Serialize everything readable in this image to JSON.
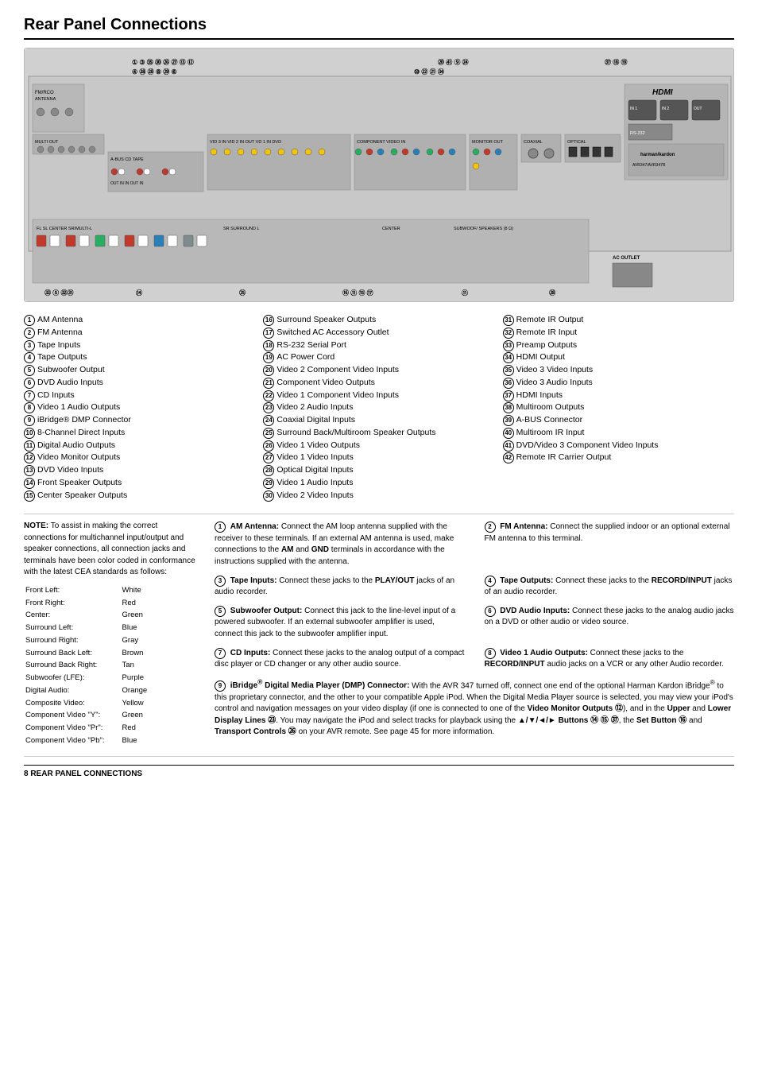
{
  "page": {
    "title": "Rear Panel Connections",
    "footer": "8   REAR PANEL CONNECTIONS"
  },
  "items": {
    "column1": [
      {
        "num": "1",
        "label": "AM Antenna"
      },
      {
        "num": "2",
        "label": "FM Antenna"
      },
      {
        "num": "3",
        "label": "Tape Inputs"
      },
      {
        "num": "4",
        "label": "Tape Outputs"
      },
      {
        "num": "5",
        "label": "Subwoofer Output"
      },
      {
        "num": "6",
        "label": "DVD Audio Inputs"
      },
      {
        "num": "7",
        "label": "CD Inputs"
      },
      {
        "num": "8",
        "label": "Video 1 Audio Outputs"
      },
      {
        "num": "9",
        "label": "iBridge® DMP Connector"
      },
      {
        "num": "10",
        "label": "8-Channel Direct Inputs"
      },
      {
        "num": "11",
        "label": "Digital Audio Outputs"
      },
      {
        "num": "12",
        "label": "Video Monitor Outputs"
      },
      {
        "num": "13",
        "label": "DVD Video Inputs"
      },
      {
        "num": "14",
        "label": "Front Speaker Outputs"
      },
      {
        "num": "15",
        "label": "Center Speaker Outputs"
      }
    ],
    "column2": [
      {
        "num": "16",
        "label": "Surround Speaker Outputs"
      },
      {
        "num": "17",
        "label": "Switched AC Accessory Outlet"
      },
      {
        "num": "18",
        "label": "RS-232 Serial Port"
      },
      {
        "num": "19",
        "label": "AC Power Cord"
      },
      {
        "num": "20",
        "label": "Video 2 Component Video Inputs"
      },
      {
        "num": "21",
        "label": "Component Video Outputs"
      },
      {
        "num": "22",
        "label": "Video 1 Component Video Inputs"
      },
      {
        "num": "23",
        "label": "Video 2 Audio Inputs"
      },
      {
        "num": "24",
        "label": "Coaxial Digital Inputs"
      },
      {
        "num": "25",
        "label": "Surround Back/Multiroom Speaker Outputs"
      },
      {
        "num": "26",
        "label": "Video 1 Video Outputs"
      },
      {
        "num": "27",
        "label": "Video 1 Video Inputs"
      },
      {
        "num": "28",
        "label": "Optical Digital Inputs"
      },
      {
        "num": "29",
        "label": "Video 1 Audio Inputs"
      },
      {
        "num": "30",
        "label": "Video 2 Video Inputs"
      }
    ],
    "column3": [
      {
        "num": "31",
        "label": "Remote IR Output"
      },
      {
        "num": "32",
        "label": "Remote IR Input"
      },
      {
        "num": "33",
        "label": "Preamp Outputs"
      },
      {
        "num": "34",
        "label": "HDMI Output"
      },
      {
        "num": "35",
        "label": "Video 3 Video Inputs"
      },
      {
        "num": "36",
        "label": "Video 3 Audio Inputs"
      },
      {
        "num": "37",
        "label": "HDMI Inputs"
      },
      {
        "num": "38",
        "label": "Multiroom Outputs"
      },
      {
        "num": "39",
        "label": "A-BUS Connector"
      },
      {
        "num": "40",
        "label": "Multiroom IR Input"
      },
      {
        "num": "41",
        "label": "DVD/Video 3 Component Video Inputs"
      },
      {
        "num": "42",
        "label": "Remote IR Carrier Output"
      }
    ]
  },
  "note": {
    "heading": "NOTE:",
    "text": "To assist in making the correct connections for multichannel input/output and speaker connections, all connection jacks and terminals have been color coded in conformance with the latest CEA standards as follows:",
    "colors": [
      {
        "label": "Front Left:",
        "value": "White"
      },
      {
        "label": "Front Right:",
        "value": "Red"
      },
      {
        "label": "Center:",
        "value": "Green"
      },
      {
        "label": "Surround Left:",
        "value": "Blue"
      },
      {
        "label": "Surround Right:",
        "value": "Gray"
      },
      {
        "label": "Surround Back Left:",
        "value": "Brown"
      },
      {
        "label": "Surround Back Right:",
        "value": "Tan"
      },
      {
        "label": "Subwoofer (LFE):",
        "value": "Purple"
      },
      {
        "label": "Digital Audio:",
        "value": "Orange"
      },
      {
        "label": "Composite Video:",
        "value": "Yellow"
      },
      {
        "label": "Component Video \"Y\":",
        "value": "Green"
      },
      {
        "label": "Component Video \"Pr\":",
        "value": "Red"
      },
      {
        "label": "Component Video \"Pb\":",
        "value": "Blue"
      }
    ]
  },
  "descriptions": [
    {
      "num": "1",
      "title": "AM Antenna:",
      "text": "Connect the AM loop antenna supplied with the receiver to these terminals. If an external AM antenna is used, make connections to the AM and GND terminals in accordance with the instructions supplied with the antenna."
    },
    {
      "num": "2",
      "title": "FM Antenna:",
      "text": "Connect the supplied indoor or an optional external FM antenna to this terminal."
    },
    {
      "num": "3",
      "title": "Tape Inputs:",
      "text": "Connect these jacks to the PLAY/OUT jacks of an audio recorder."
    },
    {
      "num": "4",
      "title": "Tape Outputs:",
      "text": "Connect these jacks to the RECORD/INPUT jacks of an audio recorder."
    },
    {
      "num": "5",
      "title": "Subwoofer Output:",
      "text": "Connect this jack to the line-level input of a powered subwoofer. If an external subwoofer amplifier is used, connect this jack to the subwoofer amplifier input."
    },
    {
      "num": "6",
      "title": "DVD Audio Inputs:",
      "text": "Connect these jacks to the analog audio jacks on a DVD or other audio or video source."
    },
    {
      "num": "7",
      "title": "CD Inputs:",
      "text": "Connect these jacks to the analog output of a compact disc player or CD changer or any other audio source."
    },
    {
      "num": "8",
      "title": "Video 1 Audio Outputs:",
      "text": "Connect these jacks to the RECORD/INPUT audio jacks on a VCR or any other Audio recorder."
    },
    {
      "num": "9",
      "title": "iBridge® Digital Media Player (DMP) Connector:",
      "text": "With the AVR 347 turned off, connect one end of the optional Harman Kardon iBridge®  to this proprietary connector, and the other to your compatible Apple iPod. When the Digital Media Player source is selected, you may view your iPod's control and navigation messages on your video display (if one is connected to one of the Video Monitor Outputs ⑫), and in the Upper and Lower Display Lines ㉓. You may navigate the iPod and select tracks for playback using the ▲/▼/◄/► Buttons ⑭ ⑮ ㊲, the Set Button ⑯ and Transport Controls ㉖ on your AVR remote. See page 45 for more information."
    }
  ]
}
